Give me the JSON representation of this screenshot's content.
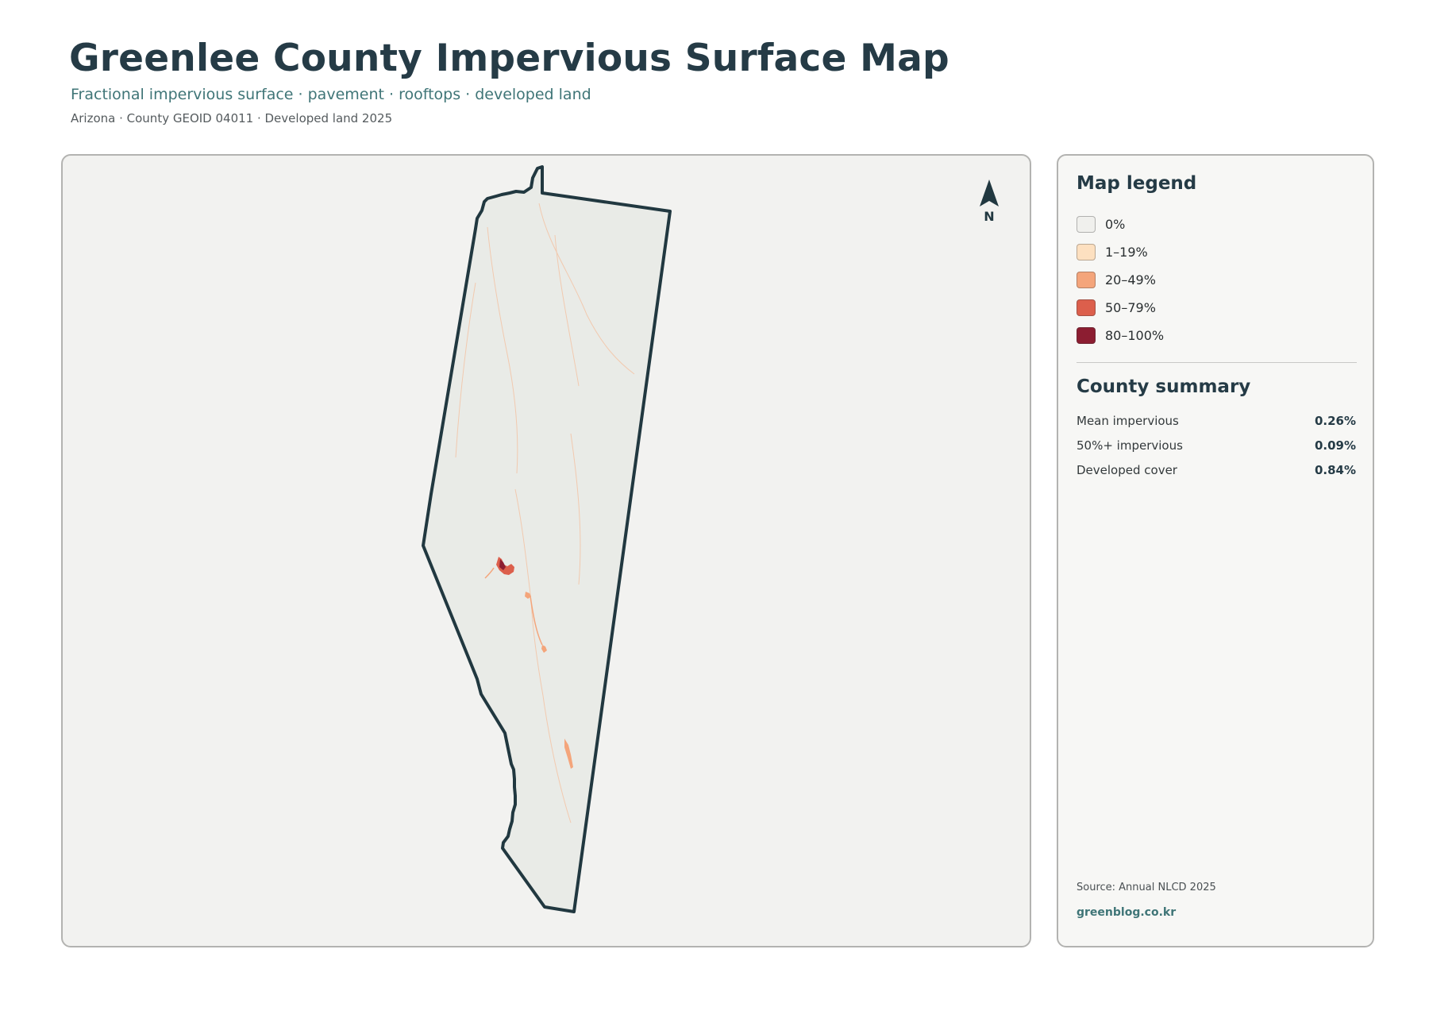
{
  "header": {
    "title": "Greenlee County Impervious Surface Map",
    "subtitle": "Fractional impervious surface · pavement · rooftops · developed land",
    "meta": "Arizona · County GEOID 04011 · Developed land 2025"
  },
  "map": {
    "north_arrow_label": "N",
    "county_fill_color": "#e9ebe7",
    "boundary_color": "#213840"
  },
  "legend": {
    "title": "Map legend",
    "items": [
      {
        "label": "0%",
        "color": "#f0f0ed"
      },
      {
        "label": "1–19%",
        "color": "#fde0c0"
      },
      {
        "label": "20–49%",
        "color": "#f4a57b"
      },
      {
        "label": "50–79%",
        "color": "#dc5f4c"
      },
      {
        "label": "80–100%",
        "color": "#8c1d31"
      }
    ]
  },
  "summary": {
    "title": "County summary",
    "rows": [
      {
        "label": "Mean impervious",
        "value": "0.26%"
      },
      {
        "label": "50%+ impervious",
        "value": "0.09%"
      },
      {
        "label": "Developed cover",
        "value": "0.84%"
      }
    ]
  },
  "footer": {
    "source": "Source: Annual NLCD 2025",
    "site": "greenblog.co.kr"
  }
}
